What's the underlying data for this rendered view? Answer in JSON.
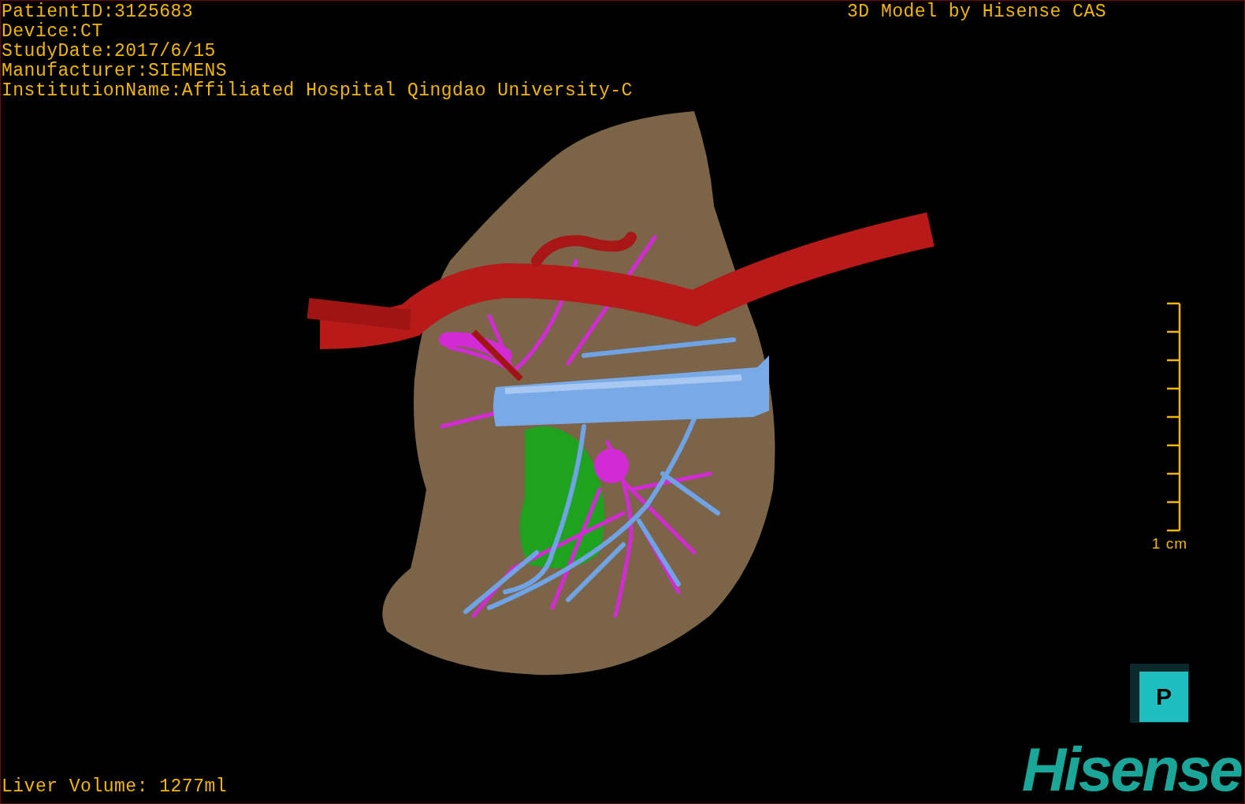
{
  "info_lines": [
    "PatientID:3125683",
    "Device:CT",
    "StudyDate:2017/6/15",
    "Manufacturer:SIEMENS",
    "InstitutionName:Affiliated Hospital Qingdao University-C"
  ],
  "title": "3D Model by Hisense CAS",
  "scale_bar": {
    "label": "1 cm"
  },
  "liver_volume": "Liver Volume: 1277ml",
  "orientation_cube": {
    "label": "P"
  },
  "logo": "Hisense"
}
